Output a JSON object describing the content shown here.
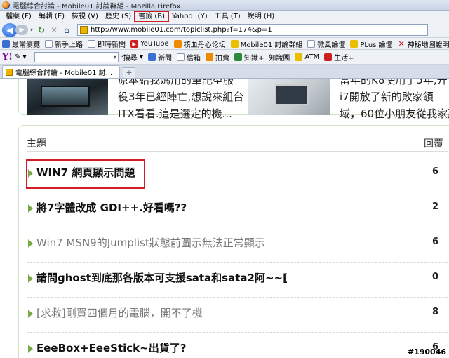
{
  "window": {
    "title": "電腦綜合討論 - Mobile01 討論群組 - Mozilla Firefox"
  },
  "menu": [
    "檔案 (F)",
    "編輯 (E)",
    "檢視 (V)",
    "歷史 (S)",
    "書籤 (B)",
    "Yahoo! (Y)",
    "工具 (T)",
    "說明 (H)"
  ],
  "nav": {
    "back_glyph": "◀",
    "forward_glyph": "▶",
    "url": "http://www.mobile01.com/topiclist.php?f=174&p=1"
  },
  "bookmarks": [
    {
      "label": "最常瀏覽",
      "icon": "blue"
    },
    {
      "label": "新手上路",
      "icon": "page"
    },
    {
      "label": "即時新聞",
      "icon": "page"
    },
    {
      "label": "YouTube",
      "icon": "red"
    },
    {
      "label": "核血丹心论坛",
      "icon": "orange"
    },
    {
      "label": "Mobile01 討論群組",
      "icon": "yellow"
    },
    {
      "label": "微風論壇",
      "icon": "page"
    },
    {
      "label": "PLus 論壇",
      "icon": "yellow"
    },
    {
      "label": "神秘地圖證明外星人",
      "icon": "xred"
    }
  ],
  "yahoo": {
    "logo": "Y!",
    "search_label": "搜尋",
    "tools": [
      "新聞",
      "信箱",
      "拍賣",
      "知識+",
      "知識團",
      "ATM",
      "生活+"
    ]
  },
  "tab": {
    "label": "電腦綜合討論 - Mobile01 討...",
    "new_tab": "+"
  },
  "top_snippets": {
    "left": [
      "原本給我媽用的筆記型服",
      "役3年已經陣亡,想說來組台",
      "ITX看看.這是選定的機..."
    ],
    "right": [
      "富年的K8使用了5年,开",
      "i7開放了新的敗家領",
      "域，60位小朋友從我家羸"
    ]
  },
  "list": {
    "header_topic": "主題",
    "header_replies": "回覆",
    "rows": [
      {
        "topic": "WIN7 網頁顯示問題",
        "replies": "6",
        "visited": false
      },
      {
        "topic": "將7字體改成 GDI++.好看嗎??",
        "replies": "2",
        "visited": false
      },
      {
        "topic": "Win7 MSN9的Jumplist狀態前圖示無法正常顯示",
        "replies": "6",
        "visited": true
      },
      {
        "topic": "請問ghost到底那各版本可支援sata和sata2阿~~[",
        "replies": "0",
        "visited": false
      },
      {
        "topic": "[求救]剛買四個月的電腦，開不了機",
        "replies": "8",
        "visited": true
      },
      {
        "topic": "EeeBox+EeeStick~出貨了?",
        "replies": "6",
        "visited": false
      }
    ]
  },
  "watermark": "#190046",
  "colors": {
    "highlight_red": "#d01c24",
    "arrow_green": "#7aa848",
    "border_green": "#cfe0c4"
  }
}
